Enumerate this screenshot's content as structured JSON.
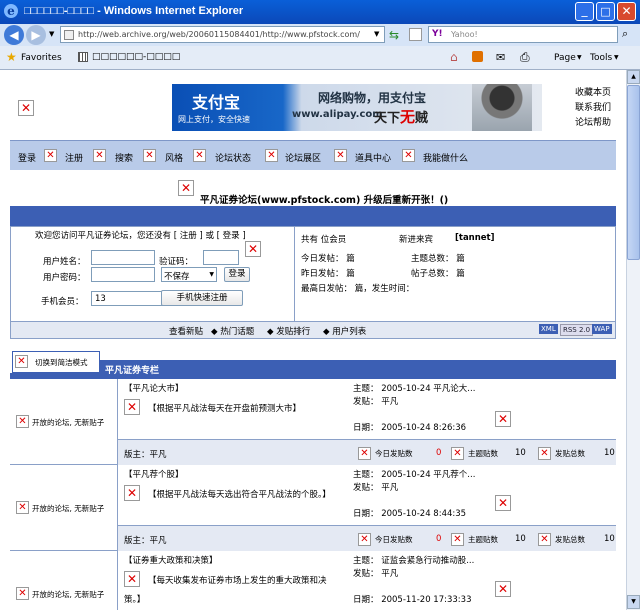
{
  "window": {
    "title": "□□□□□□-□□□□ - Windows Internet Explorer"
  },
  "address": {
    "url": "http://web.archive.org/web/20060115084401/http://www.pfstock.com/"
  },
  "search": {
    "placeholder": "Yahoo!",
    "brand": "Y!"
  },
  "favorites": {
    "label": "Favorites",
    "tab_title": "□□□□□□-□□□□"
  },
  "commandbar": {
    "page": "Page",
    "tools": "Tools"
  },
  "top_links": [
    "收藏本页",
    "联系我们",
    "论坛帮助"
  ],
  "banner": {
    "brand": "支付宝",
    "brand_sub": "网上支付，安全快速",
    "slogan": "网络购物，用支付宝",
    "url": "www.alipay.com",
    "slogan2_a": "天下",
    "slogan2_b": "无",
    "slogan2_c": "贼"
  },
  "nav": [
    "登录",
    "注册",
    "搜索",
    "风格",
    "论坛状态",
    "论坛展区",
    "道具中心",
    "我能做什么"
  ],
  "announcement": "平凡证券论坛(www.pfstock.com) 升级后重新开张！()",
  "login": {
    "welcome": "欢迎您访问平凡证券论坛，您还没有 [ 注册 ] 或 [ 登录 ]",
    "username_label": "用户姓名：",
    "code_label": "验证码：",
    "password_label": "用户密码：",
    "save_option": "不保存",
    "login_button": "登录",
    "mobile_label": "手机会员：",
    "mobile_value": "13",
    "quick_register": "手机快速注册"
  },
  "stats": {
    "members": "共有  位会员",
    "newcomer_label": "新进来宾",
    "newcomer": "[tannet]",
    "today": "今日发帖：  篇",
    "topics": "主题总数：  篇",
    "yesterday": "昨日发帖：  篇",
    "posts": "帖子总数：  篇",
    "peak": "最高日发帖：  篇，发生时间："
  },
  "quicklinks": [
    "查看新贴",
    "热门话题",
    "发贴排行",
    "用户列表"
  ],
  "feeds": [
    "XML",
    "RSS 2.0",
    "WAP"
  ],
  "mode_toggle": "切换到简洁模式",
  "section_title": "平凡证券专栏",
  "forums": [
    {
      "status": "开放的论坛, 无新贴子",
      "name": "【平凡论大市】",
      "desc": "【根据平凡战法每天在开盘前预测大市】",
      "moderator": "版主：平凡",
      "topic": "主题：  2005-10-24 平凡论大...",
      "poster": "发贴：  平凡",
      "date": "日期：  2005-10-24 8:26:36",
      "today_label": "今日发贴数",
      "today": "0",
      "topics_label": "主题贴数",
      "topics": "10",
      "posts_label": "发贴总数",
      "posts": "10"
    },
    {
      "status": "开放的论坛, 无新贴子",
      "name": "【平凡荐个股】",
      "desc": "【根据平凡战法每天选出符合平凡战法的个股。】",
      "moderator": "版主：平凡",
      "topic": "主题：  2005-10-24 平凡荐个...",
      "poster": "发贴：  平凡",
      "date": "日期：  2005-10-24 8:44:35",
      "today_label": "今日发贴数",
      "today": "0",
      "topics_label": "主题贴数",
      "topics": "10",
      "posts_label": "发贴总数",
      "posts": "10"
    },
    {
      "status": "开放的论坛, 无新贴子",
      "name": "【证券重大政策和决策】",
      "desc": "【每天收集发布证券市场上发生的重大政策和决策。】",
      "topic": "主题：  证监会紧急行动推动股...",
      "poster": "发贴：  平凡",
      "date": "日期：  2005-11-20 17:33:33"
    }
  ],
  "colors": {
    "nav_bar": "#3b63b1",
    "nav_menu": "#b7c9ea",
    "header_band": "#4a6cc0"
  }
}
